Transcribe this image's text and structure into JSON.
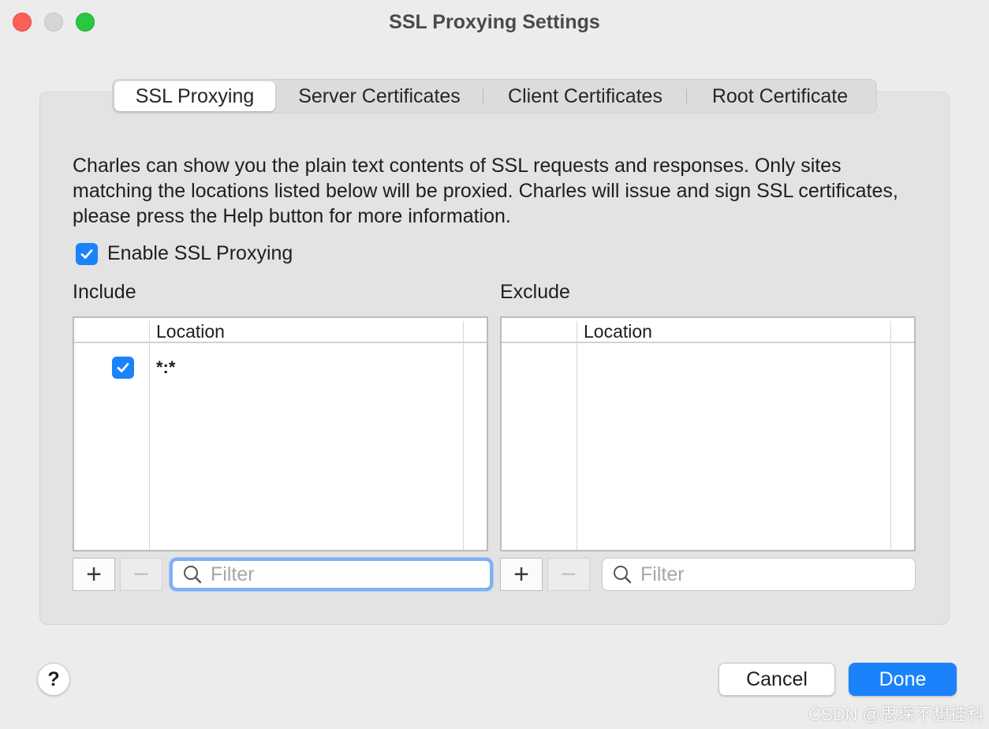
{
  "window": {
    "title": "SSL Proxying Settings"
  },
  "tabs": [
    {
      "label": "SSL Proxying",
      "selected": true
    },
    {
      "label": "Server Certificates",
      "selected": false
    },
    {
      "label": "Client Certificates",
      "selected": false
    },
    {
      "label": "Root Certificate",
      "selected": false
    }
  ],
  "description": "Charles can show you the plain text contents of SSL requests and responses. Only sites matching the locations listed below will be proxied. Charles will issue and sign SSL certificates, please press the Help button for more information.",
  "enable": {
    "label": "Enable SSL Proxying",
    "checked": true
  },
  "include": {
    "label": "Include",
    "column_header": "Location",
    "rows": [
      {
        "enabled": true,
        "location": "*:*"
      }
    ],
    "filter_placeholder": "Filter",
    "add_symbol": "+",
    "remove_symbol": "−"
  },
  "exclude": {
    "label": "Exclude",
    "column_header": "Location",
    "rows": [],
    "filter_placeholder": "Filter",
    "add_symbol": "+",
    "remove_symbol": "−"
  },
  "footer": {
    "help_symbol": "?",
    "cancel_label": "Cancel",
    "done_label": "Done"
  },
  "watermark": "CSDN @思琛不想挂科",
  "colors": {
    "accent": "#1a82fb",
    "window_bg": "#ececec",
    "close": "#fe5f57",
    "zoom": "#28c840"
  }
}
